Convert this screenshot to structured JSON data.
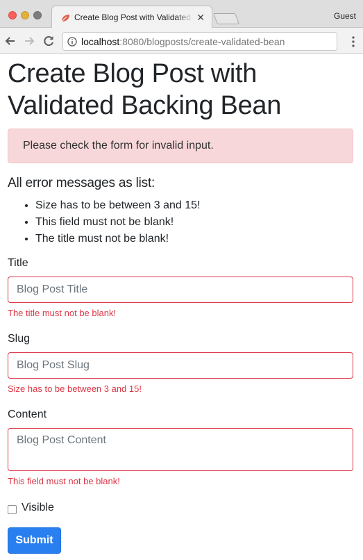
{
  "browser": {
    "tab_title": "Create Blog Post with Validated Backing Bean",
    "profile_label": "Guest",
    "url_host": "localhost",
    "url_rest": ":8080/blogposts/create-validated-bean",
    "icons": {
      "back": "arrow-left-icon",
      "forward": "arrow-right-icon",
      "reload": "reload-icon",
      "info": "info-icon",
      "menu": "kebab-menu-icon",
      "tab_close": "close-icon"
    }
  },
  "page": {
    "title": "Create Blog Post with Validated Backing Bean",
    "alert": "Please check the form for invalid input.",
    "errors_heading": "All error messages as list:",
    "errors": [
      "Size has to be between 3 and 15!",
      "This field must not be blank!",
      "The title must not be blank!"
    ]
  },
  "form": {
    "title": {
      "label": "Title",
      "value": "",
      "placeholder": "Blog Post Title",
      "error": "The title must not be blank!"
    },
    "slug": {
      "label": "Slug",
      "value": "",
      "placeholder": "Blog Post Slug",
      "error": "Size has to be between 3 and 15!"
    },
    "content": {
      "label": "Content",
      "value": "",
      "placeholder": "Blog Post Content",
      "error": "This field must not be blank!"
    },
    "visible": {
      "label": "Visible",
      "checked": false
    },
    "submit_label": "Submit"
  },
  "colors": {
    "error": "#dc3545",
    "alert_bg": "#f8d7da",
    "primary": "#2a7ff0"
  }
}
